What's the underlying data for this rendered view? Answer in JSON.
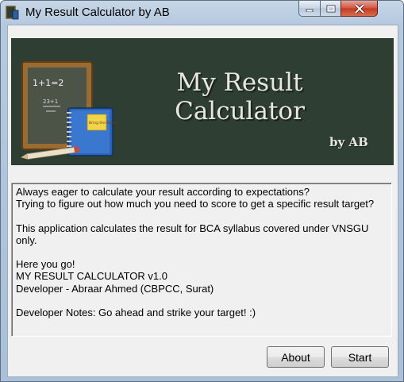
{
  "window": {
    "title": "My Result Calculator by AB"
  },
  "banner": {
    "title_line1": "My Result",
    "title_line2": "Calculator",
    "byline": "by AB",
    "art": {
      "chalkboard_text": "1+1=2",
      "notebook_note": "Bring the Books",
      "board_scribble": "23+1"
    }
  },
  "info": {
    "lines": [
      "Always eager to calculate your result according to expectations?",
      "Trying to figure out how much you need to score to get a specific result target?",
      "",
      "This application calculates the result for BCA syllabus covered under VNSGU only.",
      "",
      "Here you go!",
      "MY RESULT CALCULATOR v1.0",
      "Developer - Abraar Ahmed (CBPCC, Surat)",
      "",
      "Developer Notes: Go ahead and strike your target! :)"
    ]
  },
  "buttons": {
    "about": "About",
    "start": "Start"
  },
  "colors": {
    "banner_bg": "#2f3e32",
    "banner_text": "#e7e7e0",
    "close_red": "#c03a23"
  },
  "icons": [
    "app-icon",
    "minimize-icon",
    "maximize-icon",
    "close-icon"
  ]
}
